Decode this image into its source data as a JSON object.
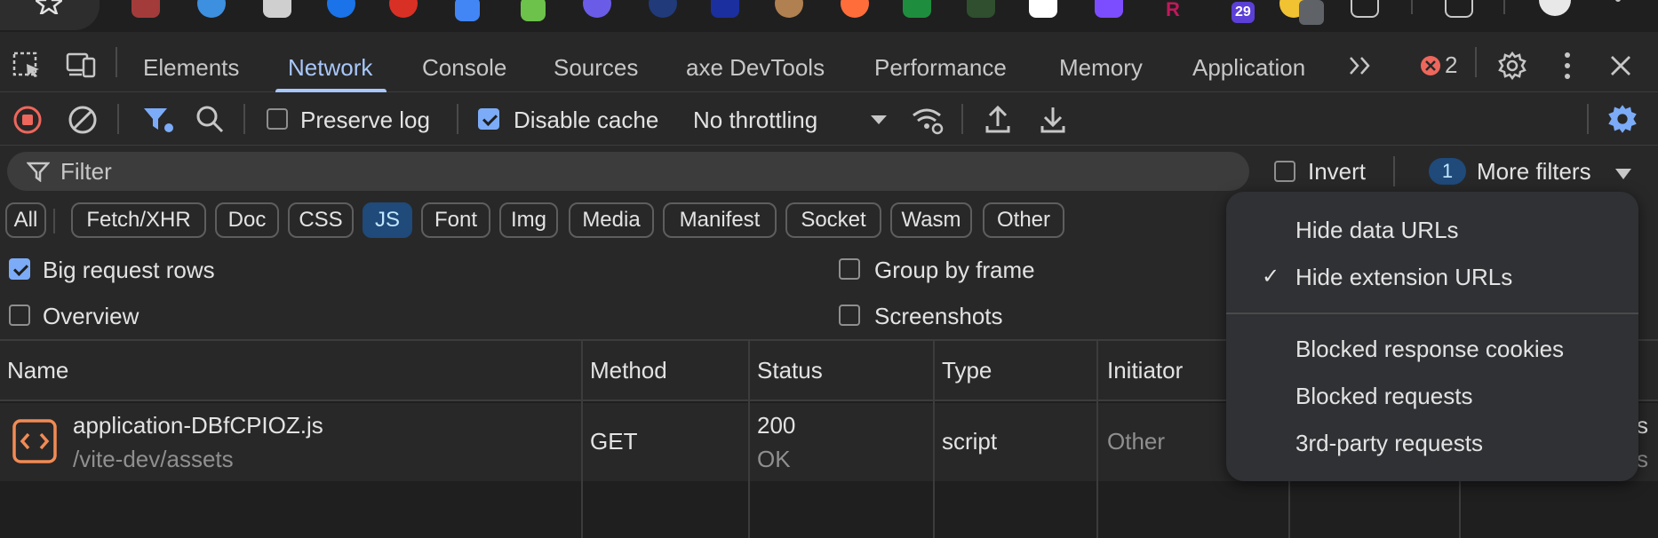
{
  "tabs": [
    "Elements",
    "Network",
    "Console",
    "Sources",
    "axe DevTools",
    "Performance",
    "Memory",
    "Application"
  ],
  "active_tab": "Network",
  "error_count": "2",
  "extension_badge": "29",
  "toolbar": {
    "preserve_log": "Preserve log",
    "disable_cache": "Disable cache",
    "throttling": "No throttling"
  },
  "filter": {
    "placeholder": "Filter",
    "invert": "Invert",
    "more_filters_count": "1",
    "more_filters": "More filters"
  },
  "chips": [
    "All",
    "Fetch/XHR",
    "Doc",
    "CSS",
    "JS",
    "Font",
    "Img",
    "Media",
    "Manifest",
    "Socket",
    "Wasm",
    "Other"
  ],
  "active_chip": "JS",
  "options": {
    "big_request_rows": "Big request rows",
    "overview": "Overview",
    "group_by_frame": "Group by frame",
    "screenshots": "Screenshots"
  },
  "table": {
    "headers": [
      "Name",
      "Method",
      "Status",
      "Type",
      "Initiator"
    ],
    "row": {
      "name": "application-DBfCPIOZ.js",
      "path": "/vite-dev/assets",
      "method": "GET",
      "status": "200",
      "status_text": "OK",
      "type": "script",
      "initiator": "Other",
      "trail_top": "s",
      "trail_bottom": "s"
    }
  },
  "dropdown": {
    "items": [
      "Hide data URLs",
      "Hide extension URLs",
      "Blocked response cookies",
      "Blocked requests",
      "3rd-party requests"
    ],
    "checked": "Hide extension URLs"
  },
  "colors": {
    "accent": "#a8c7fa",
    "checkbox_on": "#7cacf8",
    "record_stop": "#ee675c",
    "settings_blue": "#7cacf8"
  }
}
